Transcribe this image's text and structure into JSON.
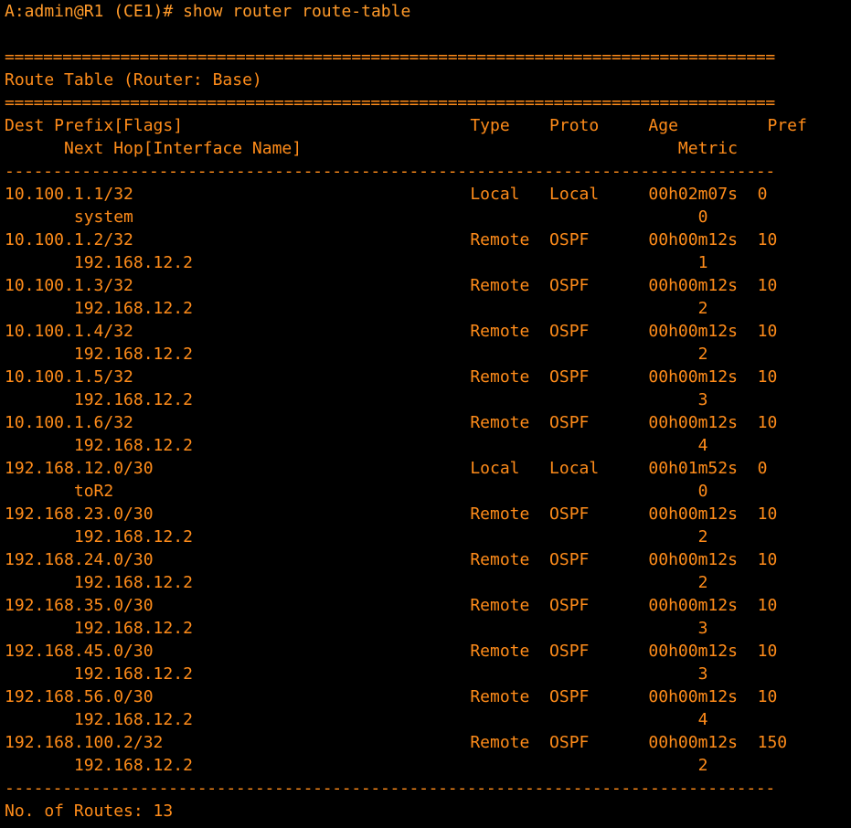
{
  "terminal": {
    "prompt_line": "A:admin@R1 (CE1)# show router route-table",
    "sep_double": "================================================================================",
    "title": "Route Table (Router: Base)",
    "sep_single": "--------------------------------------------------------------------------------",
    "header1": "Dest Prefix[Flags]                             Type    Proto     Age         Pref",
    "header2": "      Next Hop[Interface Name]                                      Metric",
    "rows": [
      {
        "main": "10.100.1.1/32                                  Local   Local     00h02m07s  0",
        "sub": "       system                                                         0"
      },
      {
        "main": "10.100.1.2/32                                  Remote  OSPF      00h00m12s  10",
        "sub": "       192.168.12.2                                                   1"
      },
      {
        "main": "10.100.1.3/32                                  Remote  OSPF      00h00m12s  10",
        "sub": "       192.168.12.2                                                   2"
      },
      {
        "main": "10.100.1.4/32                                  Remote  OSPF      00h00m12s  10",
        "sub": "       192.168.12.2                                                   2"
      },
      {
        "main": "10.100.1.5/32                                  Remote  OSPF      00h00m12s  10",
        "sub": "       192.168.12.2                                                   3"
      },
      {
        "main": "10.100.1.6/32                                  Remote  OSPF      00h00m12s  10",
        "sub": "       192.168.12.2                                                   4"
      },
      {
        "main": "192.168.12.0/30                                Local   Local     00h01m52s  0",
        "sub": "       toR2                                                           0"
      },
      {
        "main": "192.168.23.0/30                                Remote  OSPF      00h00m12s  10",
        "sub": "       192.168.12.2                                                   2"
      },
      {
        "main": "192.168.24.0/30                                Remote  OSPF      00h00m12s  10",
        "sub": "       192.168.12.2                                                   2"
      },
      {
        "main": "192.168.35.0/30                                Remote  OSPF      00h00m12s  10",
        "sub": "       192.168.12.2                                                   3"
      },
      {
        "main": "192.168.45.0/30                                Remote  OSPF      00h00m12s  10",
        "sub": "       192.168.12.2                                                   3"
      },
      {
        "main": "192.168.56.0/30                                Remote  OSPF      00h00m12s  10",
        "sub": "       192.168.12.2                                                   4"
      },
      {
        "main": "192.168.100.2/32                               Remote  OSPF      00h00m12s  150",
        "sub": "       192.168.12.2                                                   2"
      }
    ],
    "footer": "No. of Routes: 13"
  },
  "colors": {
    "background": "#000000",
    "text": "#ff8c1a"
  }
}
